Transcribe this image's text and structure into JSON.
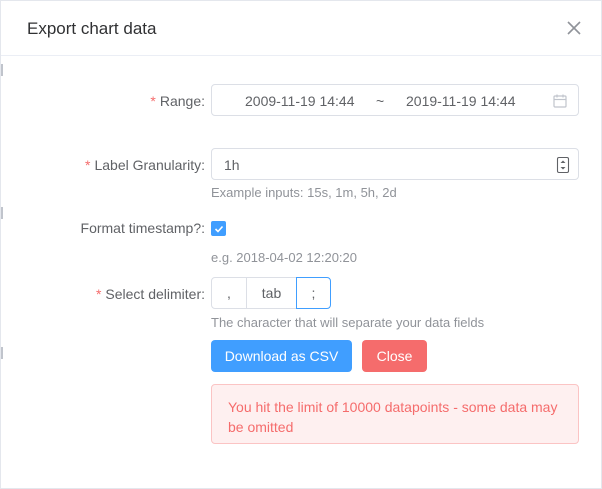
{
  "dialog": {
    "title": "Export chart data",
    "close_icon": "close-x-icon"
  },
  "range": {
    "label": "Range",
    "required": "*",
    "colon": ":",
    "start": "2009-11-19 14:44",
    "separator": "~",
    "end": "2019-11-19 14:44",
    "icon": "calendar-icon"
  },
  "granularity": {
    "label": "Label Granularity",
    "required": "*",
    "colon": ":",
    "value": "1h",
    "hint": "Example inputs: 15s, 1m, 5h, 2d",
    "icon": "stepper-icon"
  },
  "timestamp": {
    "label": "Format timestamp?",
    "colon": ":",
    "checked": true,
    "hint": "e.g. 2018-04-02 12:20:20"
  },
  "delimiter": {
    "label": "Select delimiter",
    "required": "*",
    "colon": ":",
    "options": [
      ",",
      "tab",
      ";"
    ],
    "selected": ";",
    "hint": "The character that will separate your data fields"
  },
  "actions": {
    "download_label": "Download as CSV",
    "close_label": "Close"
  },
  "alert": {
    "message": "You hit the limit of 10000 datapoints - some data may be omitted"
  },
  "colors": {
    "primary": "#409eff",
    "danger": "#f56c6c",
    "alert_bg": "#fef0f0"
  }
}
